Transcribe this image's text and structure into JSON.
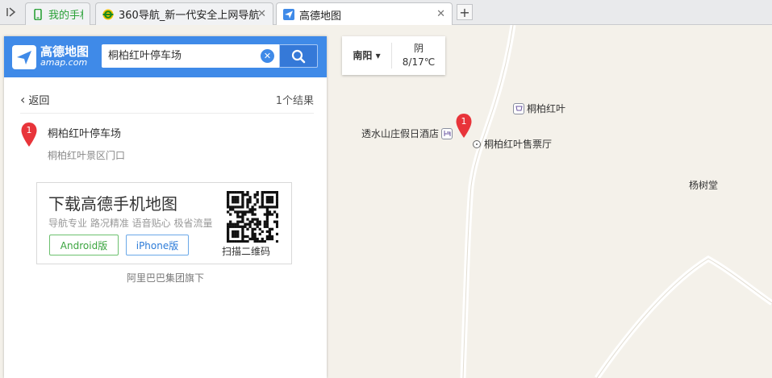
{
  "browser": {
    "sidebar_toggle_icon": "sidebar-toggle-icon",
    "tabs": [
      {
        "label": "我的手机",
        "icon": "phone-icon",
        "active": false
      },
      {
        "label": "360导航_新一代安全上网导航",
        "icon": "360-logo-icon",
        "active": false
      },
      {
        "label": "高德地图",
        "icon": "amap-logo-icon",
        "active": true
      }
    ],
    "tab_close_glyph": "✕",
    "new_tab_glyph": "+"
  },
  "search": {
    "logo_name": "高德地图",
    "logo_sub": "amap.com",
    "query": "桐柏红叶停车场",
    "clear_glyph": "✕"
  },
  "results": {
    "back_label": "返回",
    "count_label": "1个结果",
    "items": [
      {
        "marker": "1",
        "name": "桐柏红叶停车场",
        "address": "桐柏红叶景区门口"
      }
    ]
  },
  "promo": {
    "title": "下载高德手机地图",
    "subtitle": "导航专业 路况精准 语音贴心 极省流量",
    "android_label": "Android版",
    "iphone_label": "iPhone版",
    "qr_label": "扫描二维码"
  },
  "footer": "阿里巴巴集团旗下",
  "weather": {
    "city": "南阳",
    "condition": "阴",
    "temperature": "8/17℃"
  },
  "map": {
    "pois": [
      {
        "label": "桐柏红叶",
        "icon": "shopping-icon"
      },
      {
        "label": "透水山庄假日酒店",
        "icon": "hotel-icon"
      },
      {
        "label": "桐柏红叶售票厅",
        "icon": "poi-dot-icon"
      },
      {
        "label": "杨树堂",
        "icon": ""
      }
    ],
    "marker": "1"
  },
  "colors": {
    "brand_blue": "#3f8ae8",
    "marker_red": "#e8343a",
    "android_green": "#3aa43e",
    "iphone_blue": "#2c7bd8",
    "map_bg": "#f4f1ea"
  }
}
